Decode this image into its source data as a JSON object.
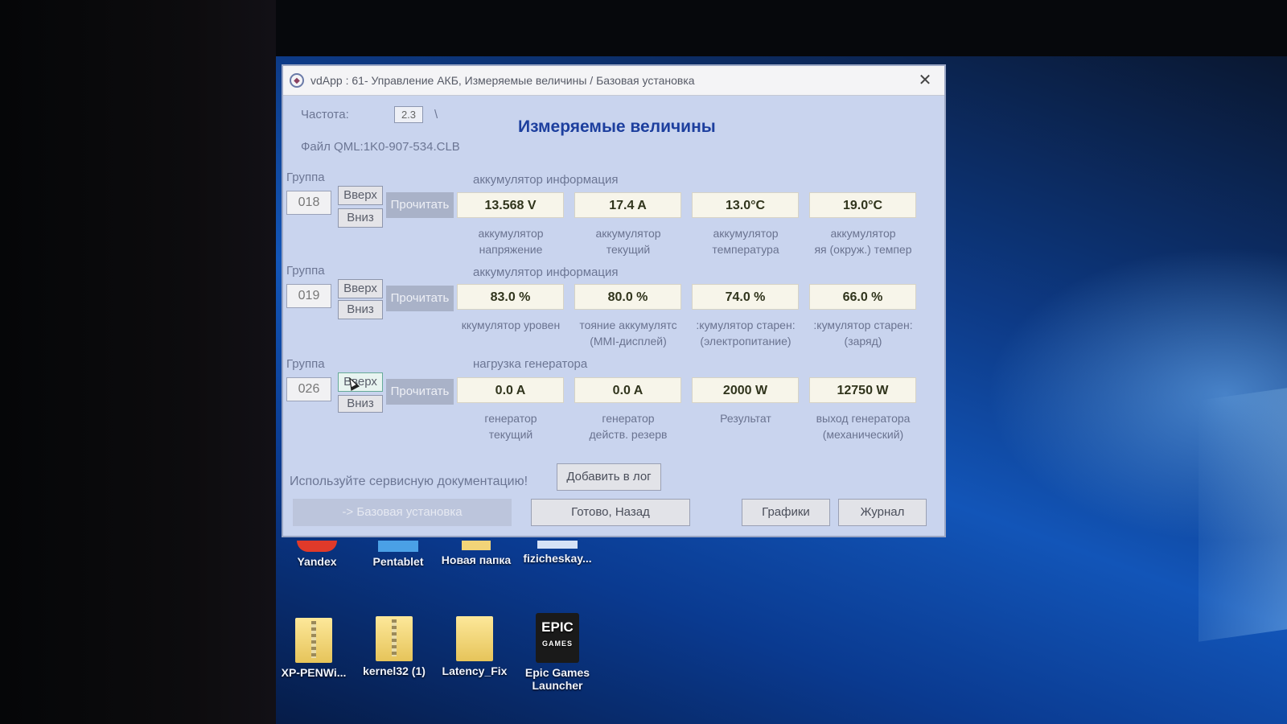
{
  "window": {
    "title": "vdApp : 61- Управление АКБ,  Измеряемые величины / Базовая установка",
    "close": "✕",
    "heading": "Измеряемые величины",
    "freq_label": "Частота:",
    "freq_value": "2.3",
    "freq_mark": "\\",
    "file_label": "Файл QML:1K0-907-534.CLB"
  },
  "groups": [
    {
      "label": "Группа",
      "number": "018",
      "up": "Вверх",
      "down": "Вниз",
      "read": "Прочитать",
      "header": "аккумулятор информация",
      "fields": [
        {
          "value": "13.568 V",
          "cap1": "аккумулятор",
          "cap2": "напряжение"
        },
        {
          "value": "17.4 A",
          "cap1": "аккумулятор",
          "cap2": "текущий"
        },
        {
          "value": "13.0°C",
          "cap1": "аккумулятор",
          "cap2": "температура"
        },
        {
          "value": "19.0°C",
          "cap1": "аккумулятор",
          "cap2": "яя (окруж.) темпер"
        }
      ]
    },
    {
      "label": "Группа",
      "number": "019",
      "up": "Вверх",
      "down": "Вниз",
      "read": "Прочитать",
      "header": "аккумулятор информация",
      "fields": [
        {
          "value": "83.0 %",
          "cap1": "ккумулятор уровен",
          "cap2": ""
        },
        {
          "value": "80.0 %",
          "cap1": "тояние аккумулятс",
          "cap2": "(MMI-дисплей)"
        },
        {
          "value": "74.0 %",
          "cap1": ":кумулятор старен:",
          "cap2": "(электропитание)"
        },
        {
          "value": "66.0 %",
          "cap1": ":кумулятор старен:",
          "cap2": "(заряд)"
        }
      ]
    },
    {
      "label": "Группа",
      "number": "026",
      "up": "Вверх",
      "down": "Вниз",
      "read": "Прочитать",
      "header": "нагрузка генератора",
      "fields": [
        {
          "value": "0.0 A",
          "cap1": "генератор",
          "cap2": "текущий"
        },
        {
          "value": "0.0 A",
          "cap1": "генератор",
          "cap2": "действ. резерв"
        },
        {
          "value": "2000 W",
          "cap1": "Результат",
          "cap2": ""
        },
        {
          "value": "12750 W",
          "cap1": "выход генератора",
          "cap2": "(механический)"
        }
      ]
    }
  ],
  "footer": {
    "hint": "Используйте сервисную документацию!",
    "add_log": "Добавить в лог",
    "basic": "-> Базовая установка",
    "done": "Готово, Назад",
    "graphs": "Графики",
    "journal": "Журнал"
  },
  "desktop": {
    "icons_row1": [
      "Yandex",
      "Pentablet",
      "Новая папка",
      "fizicheskay..."
    ],
    "icons_row2": [
      {
        "line1": "XP-PENWi...",
        "line2": ""
      },
      {
        "line1": "kernel32 (1)",
        "line2": ""
      },
      {
        "line1": "Latency_Fix",
        "line2": ""
      },
      {
        "line1": "Epic Games",
        "line2": "Launcher"
      }
    ],
    "epic_logo": "EPIC",
    "epic_logo_sub": "GAMES"
  }
}
